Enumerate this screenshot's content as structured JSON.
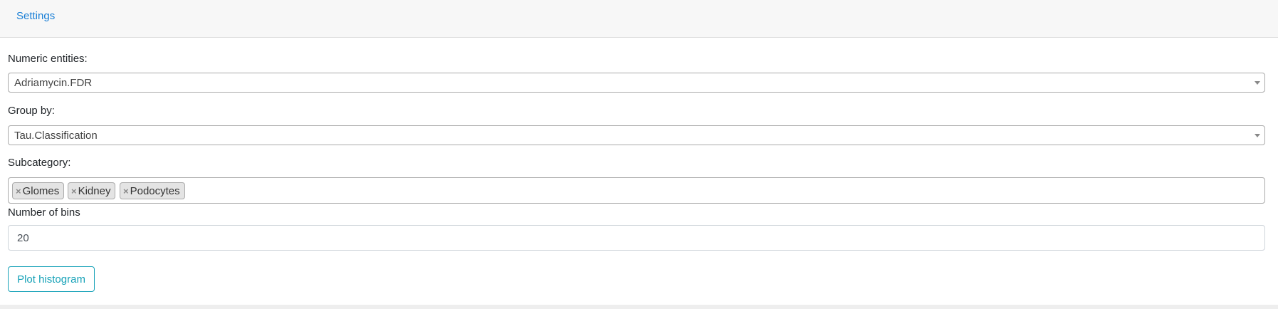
{
  "header": {
    "tab_label": "Settings"
  },
  "form": {
    "numeric_entities": {
      "label": "Numeric entities:",
      "value": "Adriamycin.FDR"
    },
    "group_by": {
      "label": "Group by:",
      "value": "Tau.Classification"
    },
    "subcategory": {
      "label": "Subcategory:",
      "chips": [
        "Glomes",
        "Kidney",
        "Podocytes"
      ],
      "remove_glyph": "×"
    },
    "bins": {
      "label": "Number of bins",
      "value": "20"
    },
    "submit_label": "Plot histogram"
  },
  "colors": {
    "link": "#1a7fd6",
    "button_accent": "#17a2b8",
    "header_bg": "#f7f7f7"
  }
}
